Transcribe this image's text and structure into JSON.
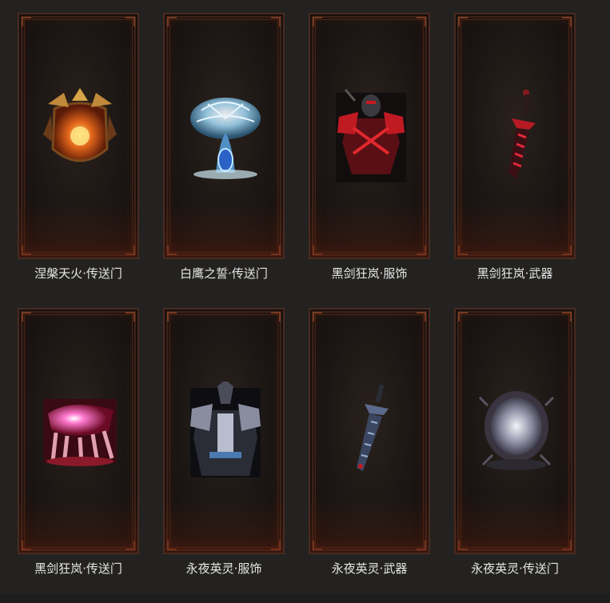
{
  "items": [
    {
      "name": "涅槃天火·传送门",
      "icon": "fire-phoenix-portal-icon"
    },
    {
      "name": "白鹰之誓·传送门",
      "icon": "ice-tree-portal-icon"
    },
    {
      "name": "黑剑狂岚·服饰",
      "icon": "red-armor-outfit-icon"
    },
    {
      "name": "黑剑狂岚·武器",
      "icon": "red-sword-weapon-icon"
    },
    {
      "name": "黑剑狂岚·传送门",
      "icon": "crimson-crystal-portal-icon"
    },
    {
      "name": "永夜英灵·服饰",
      "icon": "dark-armor-outfit-icon"
    },
    {
      "name": "永夜英灵·武器",
      "icon": "dark-blade-weapon-icon"
    },
    {
      "name": "永夜英灵·传送门",
      "icon": "silver-orb-portal-icon"
    }
  ],
  "colors": {
    "background": "#232220",
    "frame": "#4a2a20",
    "label": "#e6e6e6"
  }
}
